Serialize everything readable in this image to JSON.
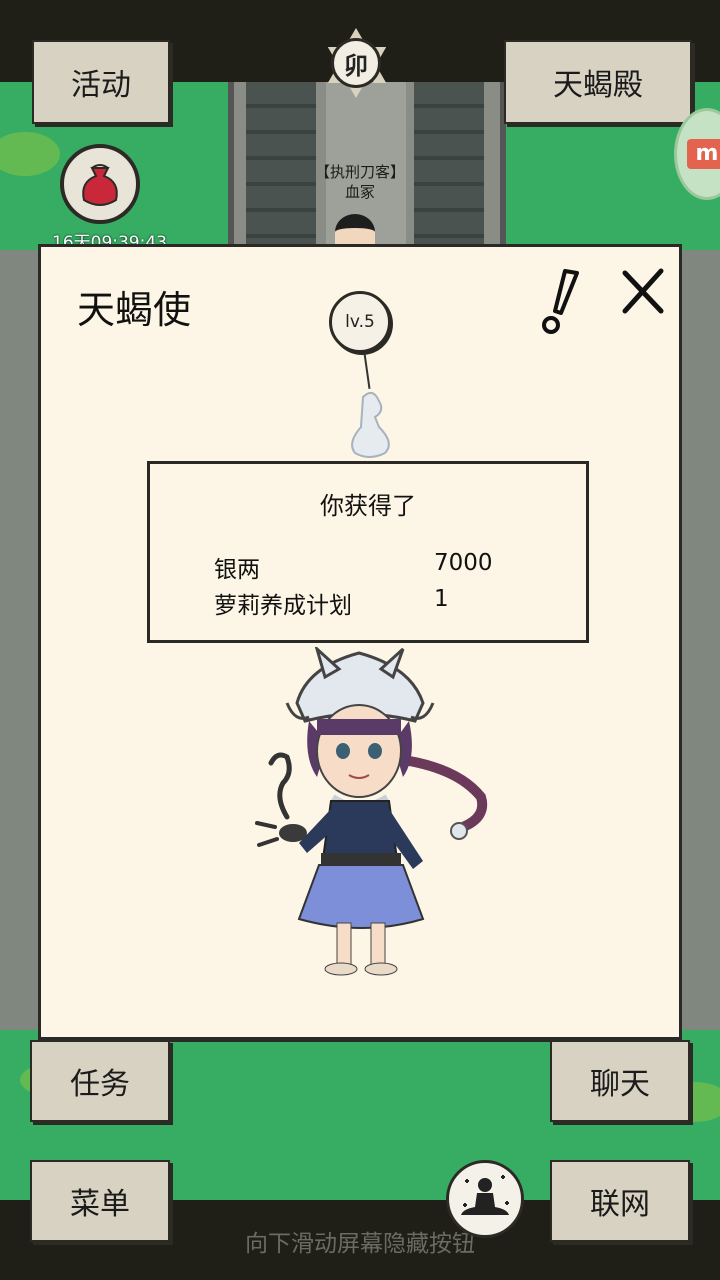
{
  "top_buttons": {
    "activity": "活动",
    "temple": "天蝎殿"
  },
  "seal": {
    "glyph": "卯"
  },
  "npc": {
    "tag": "【执刑刀客】",
    "name": "血冢"
  },
  "bag": {
    "timer": "16天09:39:43"
  },
  "badge": {
    "label": "m"
  },
  "dialog": {
    "title": "天蝎使",
    "level": "lv.5",
    "reward_title": "你获得了",
    "rewards": [
      {
        "name": "银两",
        "value": "7000"
      },
      {
        "name": "萝莉养成计划",
        "value": "1"
      }
    ]
  },
  "bottom_buttons": {
    "task": "任务",
    "chat": "聊天",
    "menu": "菜单",
    "network": "联网"
  },
  "hint": "向下滑动屏幕隐藏按钮",
  "colors": {
    "grass": "#36ad63",
    "panel": "#fdf6e6",
    "button": "#d8d2c3",
    "ink": "#2a2925"
  }
}
